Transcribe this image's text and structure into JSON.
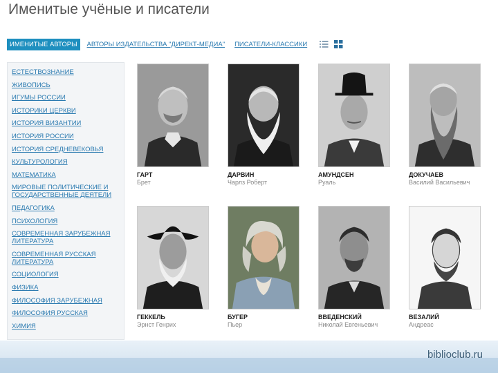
{
  "header": {
    "title": "Именитые учёные и писатели"
  },
  "tabs": [
    {
      "label": "ИМЕНИТЫЕ АВТОРЫ"
    },
    {
      "label": "АВТОРЫ ИЗДАТЕЛЬСТВА \"ДИРЕКТ-МЕДИА\""
    },
    {
      "label": "ПИСАТЕЛИ-КЛАССИКИ"
    }
  ],
  "view_icons": [
    "list-view-icon",
    "grid-view-icon"
  ],
  "sidebar": {
    "items": [
      "ЕСТЕСТВОЗНАНИЕ",
      "ЖИВОПИСЬ",
      "ИГУМЫ РОССИИ",
      "ИСТОРИКИ ЦЕРКВИ",
      "ИСТОРИЯ ВИЗАНТИИ",
      "ИСТОРИЯ РОССИИ",
      "ИСТОРИЯ СРЕДНЕВЕКОВЬЯ",
      "КУЛЬТУРОЛОГИЯ",
      "МАТЕМАТИКА",
      "МИРОВЫЕ ПОЛИТИЧЕСКИЕ И ГОСУДАРСТВЕННЫЕ ДЕЯТЕЛИ",
      "ПЕДАГОГИКА",
      "ПСИХОЛОГИЯ",
      "СОВРЕМЕННАЯ ЗАРУБЕЖНАЯ ЛИТЕРАТУРА",
      "СОВРЕМЕННАЯ РУССКАЯ ЛИТЕРАТУРА",
      "СОЦИОЛОГИЯ",
      "ФИЗИКА",
      "ФИЛОСОФИЯ ЗАРУБЕЖНАЯ",
      "ФИЛОСОФИЯ РУССКАЯ",
      "ХИМИЯ"
    ]
  },
  "authors": [
    {
      "surname": "ГАРТ",
      "first": "Брет"
    },
    {
      "surname": "ДАРВИН",
      "first": "Чарлз Роберт"
    },
    {
      "surname": "АМУНДСЕН",
      "first": "Руаль"
    },
    {
      "surname": "ДОКУЧАЕВ",
      "first": "Василий Васильевич"
    },
    {
      "surname": "ГЕККЕЛЬ",
      "first": "Эрнст Генрих"
    },
    {
      "surname": "БУГЕР",
      "first": "Пьер"
    },
    {
      "surname": "ВВЕДЕНСКИЙ",
      "first": "Николай Евгеньевич"
    },
    {
      "surname": "ВЕЗАЛИЙ",
      "first": "Андреас"
    }
  ],
  "footer": {
    "brand": "biblioclub.ru"
  },
  "colors": {
    "accent": "#1e8fbf",
    "link": "#2a7ab0",
    "sidebar_bg": "#f3f5f7"
  }
}
